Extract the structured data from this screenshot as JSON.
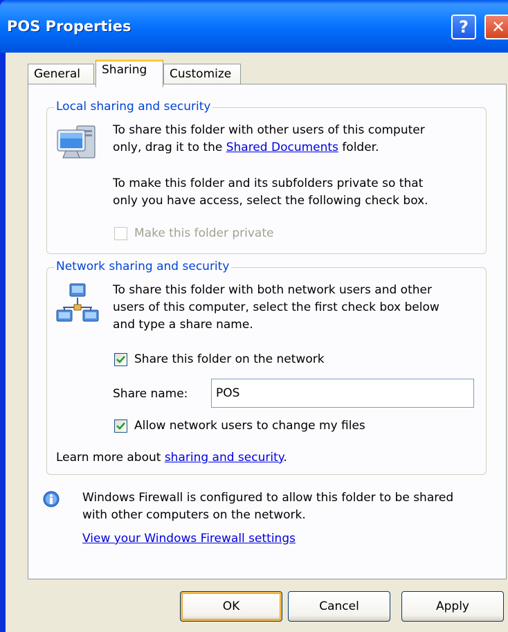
{
  "window": {
    "title": "POS Properties"
  },
  "titlebar": {
    "help_glyph": "?",
    "close_glyph": "✕"
  },
  "tabs": [
    {
      "label": "General"
    },
    {
      "label": "Sharing"
    },
    {
      "label": "Customize"
    }
  ],
  "local": {
    "title": "Local sharing and security",
    "line1": "To share this folder with other users of this computer",
    "line2_pre": "only, drag it to the ",
    "line2_link": "Shared Documents",
    "line2_post": " folder.",
    "line3": "To make this folder and its subfolders private so that",
    "line4": "only you have access, select the following check box.",
    "private_checkbox_label": "Make this folder private",
    "private_checked": false
  },
  "network": {
    "title": "Network sharing and security",
    "line1": "To share this folder with both network users and other",
    "line2": "users of this computer, select the first check box below",
    "line3": "and type a share name.",
    "share_checkbox_label": "Share this folder on the network",
    "share_checked": true,
    "share_name_label": "Share name:",
    "share_name_value": "POS",
    "allow_checkbox_label": "Allow network users to change my files",
    "allow_checked": true,
    "learn_pre": "Learn more about ",
    "learn_link": "sharing and security",
    "learn_post": "."
  },
  "firewall": {
    "line1": "Windows Firewall is configured to allow this folder to be shared",
    "line2": "with other computers on the network.",
    "link": "View your Windows Firewall settings"
  },
  "buttons": {
    "ok": "OK",
    "cancel": "Cancel",
    "apply": "Apply"
  },
  "icons": {
    "computer": "computer-icon",
    "network": "network-icon",
    "info": "info-icon"
  },
  "colors": {
    "titlebar": "#0054e3",
    "group_title": "#0046d5",
    "link": "#0000e0",
    "active_tab_accent": "#ffc83c",
    "checkmark": "#21a121"
  }
}
